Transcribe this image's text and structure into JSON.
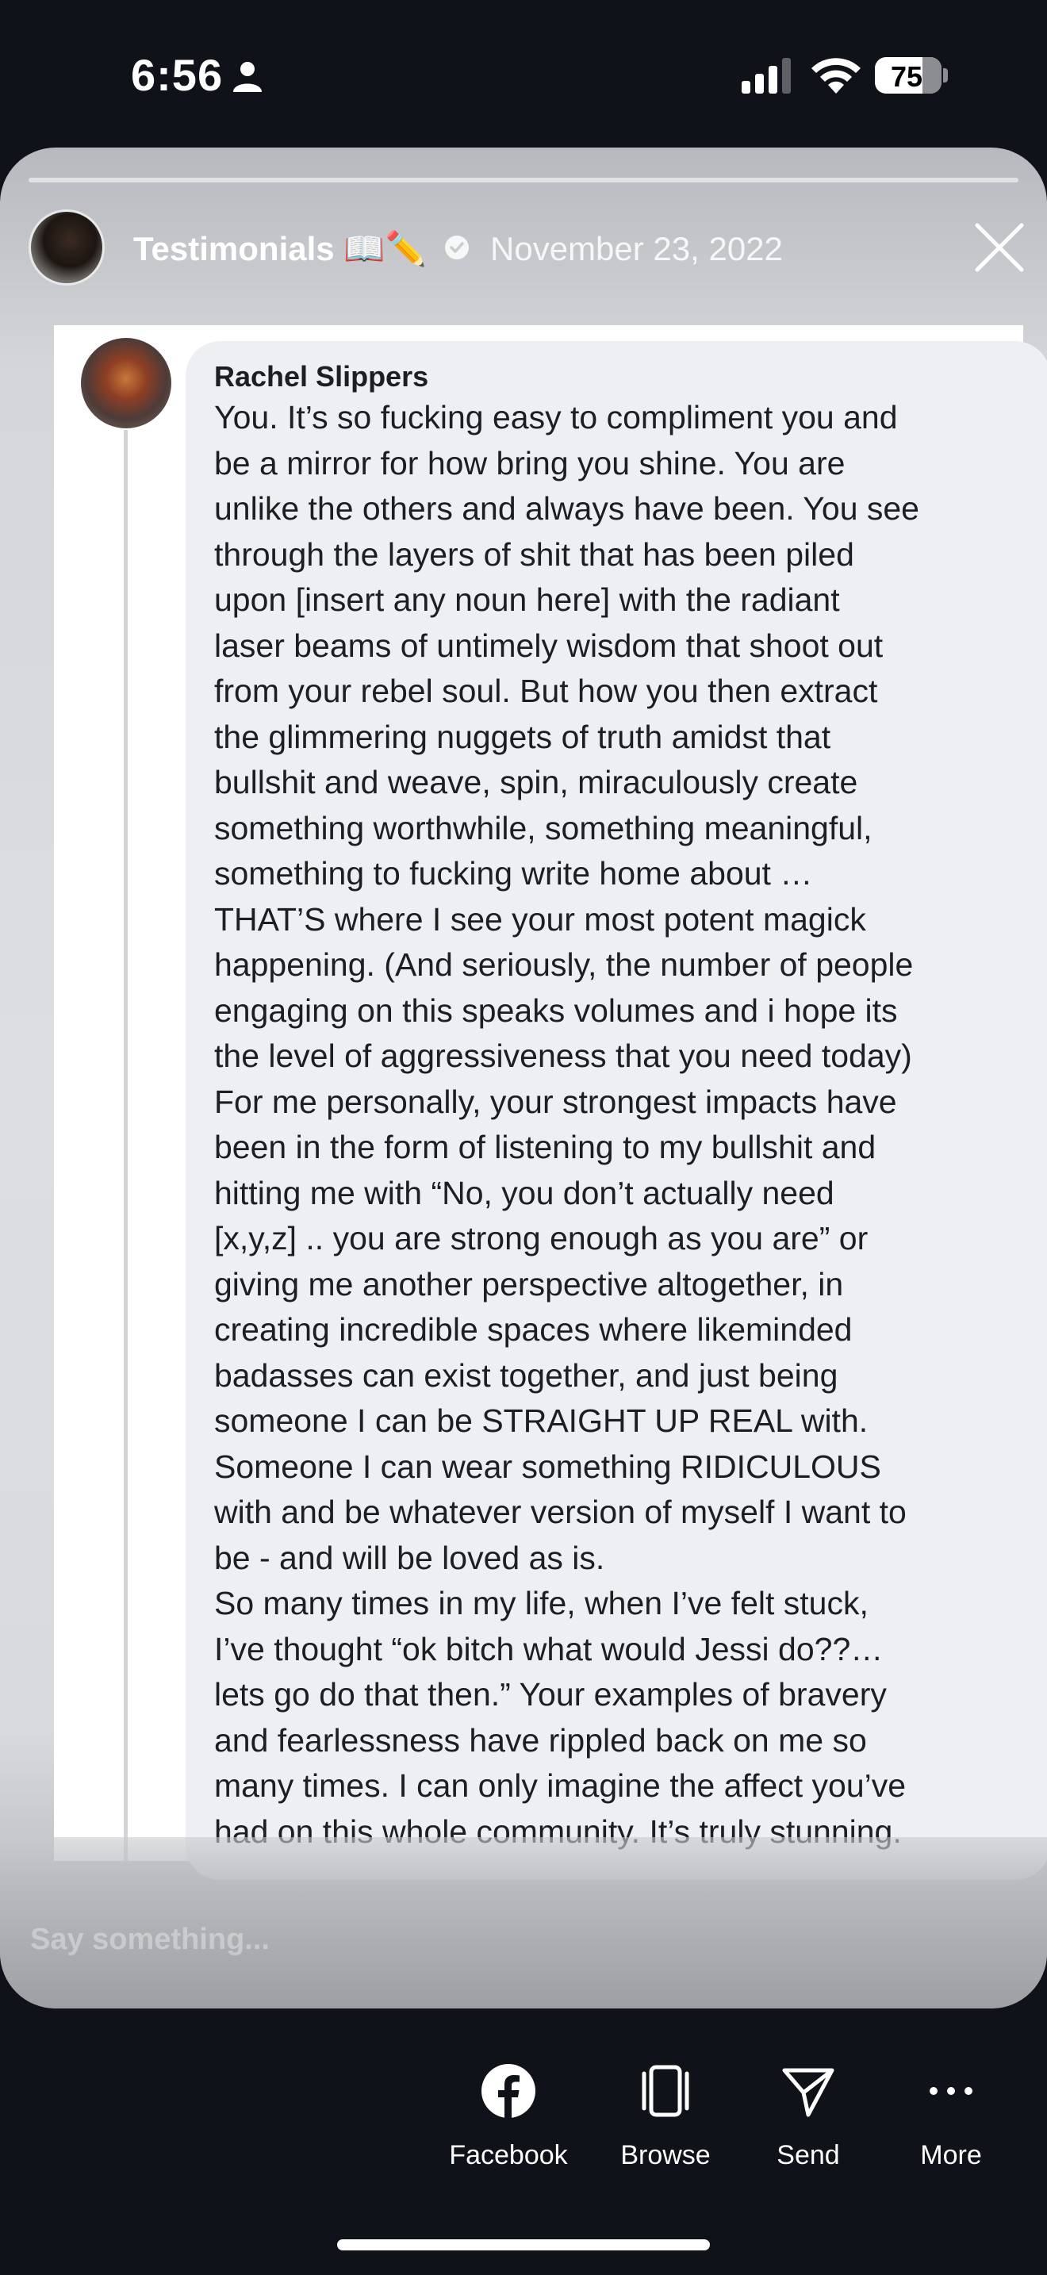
{
  "status_bar": {
    "time": "6:56",
    "battery_level": "75",
    "icons": [
      "person-icon",
      "signal-icon",
      "wifi-icon",
      "battery-icon"
    ]
  },
  "story": {
    "title": "Testimonials 📖✏️",
    "date": "November 23, 2022",
    "icons": [
      "verified-icon",
      "close-icon"
    ]
  },
  "comment": {
    "author": "Rachel Slippers",
    "lines": [
      "You. It’s so fucking easy to compliment you and",
      "be a mirror for how bring you shine. You are",
      "unlike the others and always have been. You see",
      "through the layers of shit that has been piled",
      "upon [insert any noun here] with the radiant",
      "laser beams of untimely wisdom that shoot out",
      "from your rebel soul. But how you then extract",
      "the glimmering nuggets of truth amidst that",
      "bullshit and weave, spin, miraculously create",
      "something worthwhile, something meaningful,",
      "something to fucking write home about …",
      "THAT’S where I see your most potent magick",
      "happening. (And seriously, the number of people",
      "engaging on this speaks volumes and i hope its",
      "the level of aggressiveness that you need today)",
      "For me personally, your strongest impacts have",
      "been in the form of listening to my bullshit and",
      "hitting me with “No, you don’t actually need",
      "[x,y,z] .. you are strong enough as you are” or",
      "giving me another perspective altogether, in",
      "creating incredible spaces where likeminded",
      "badasses can exist together, and just being",
      "someone I can be STRAIGHT UP REAL with.",
      "Someone I can wear something RIDICULOUS",
      "with and be whatever version of myself I want to",
      "be - and will be loved as is.",
      "So many times in my life, when I’ve felt stuck,",
      "I’ve thought “ok bitch what would Jessi do??…",
      "lets go do that then.” Your examples of bravery",
      "and fearlessness have rippled back on me so",
      "many times. I can only imagine the affect you’ve",
      "had on this whole community. It’s truly stunning."
    ]
  },
  "reply": {
    "placeholder": "Say something..."
  },
  "actions": {
    "facebook": "Facebook",
    "browse": "Browse",
    "send": "Send",
    "more": "More",
    "icons": [
      "facebook-icon",
      "browse-icon",
      "send-icon",
      "more-icon"
    ]
  }
}
